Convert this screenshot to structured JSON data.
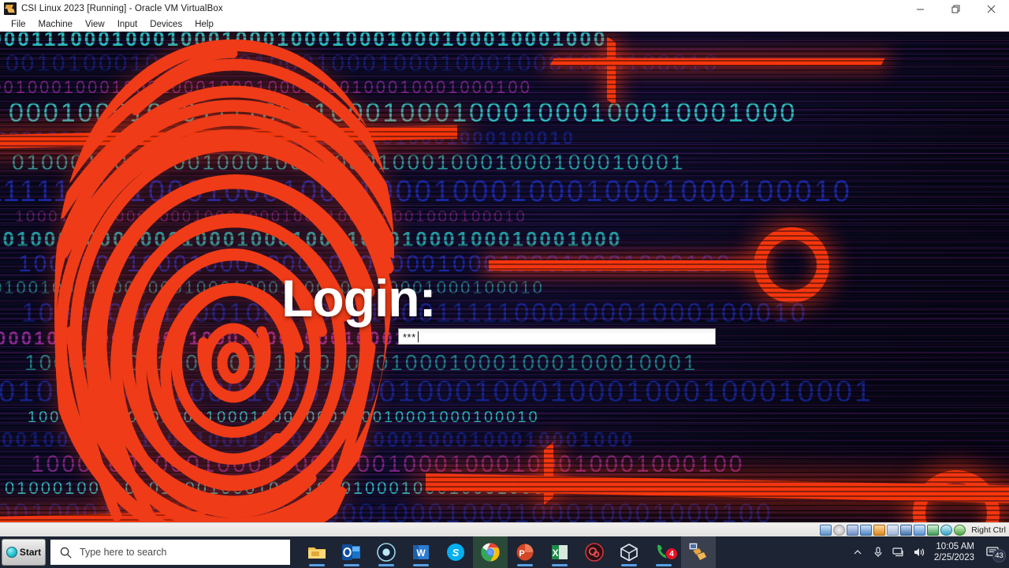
{
  "vbox": {
    "title": "CSI Linux 2023 [Running] - Oracle VM VirtualBox",
    "app_icon": "virtualbox-vm-icon",
    "menu": [
      {
        "label": "File"
      },
      {
        "label": "Machine"
      },
      {
        "label": "View"
      },
      {
        "label": "Input"
      },
      {
        "label": "Devices"
      },
      {
        "label": "Help"
      }
    ],
    "window_controls": [
      {
        "name": "minimize-button",
        "glyph": "minimize-icon"
      },
      {
        "name": "restore-button",
        "glyph": "restore-icon"
      },
      {
        "name": "close-button",
        "glyph": "close-icon"
      }
    ],
    "statusbar": {
      "host_key_label": "Right Ctrl",
      "indicators": [
        {
          "name": "hard-disk-indicator",
          "color": "#3b6fb0"
        },
        {
          "name": "optical-drive-indicator",
          "color": "#b8b8b8"
        },
        {
          "name": "floppy-indicator",
          "color": "#5a7fc0"
        },
        {
          "name": "network-indicator",
          "color": "#4a86c8"
        },
        {
          "name": "usb-indicator",
          "color": "#d8881f"
        },
        {
          "name": "shared-folders-indicator",
          "color": "#d8c468"
        },
        {
          "name": "display-indicator",
          "color": "#3f72b5"
        },
        {
          "name": "recording-indicator",
          "color": "#4d8fd0"
        },
        {
          "name": "features-indicator",
          "color": "#2f8f4f"
        },
        {
          "name": "mouse-indicator",
          "color": "#39a8c8"
        },
        {
          "name": "keyboard-indicator",
          "color": "#4aa33f"
        }
      ]
    }
  },
  "guest": {
    "login_label": "Login:",
    "password_field": {
      "value": "***",
      "masked_char": "*",
      "char_count": 3,
      "focused": true
    },
    "background": {
      "description": "binary-code-fingerprint-wallpaper",
      "colors": {
        "deep_navy": "#07081c",
        "binary_cyan": "#2fd8d8",
        "binary_blue": "#1b2db5",
        "binary_magenta": "#a12ea8",
        "trace_red": "#f4360c",
        "fingerprint_red": "#ef3b17"
      },
      "binary_rows": [
        "1000111000100010001000100010001000100010001000",
        "0010100010001000100010001000100010001000100010",
        "1001000100010001000100010001000100010001000100",
        "0001000100011110001000100010001000100010001000",
        "1000100010001000100010001000100010001000100010",
        "0100010001000100010001000100010001000100010001",
        "1111100010001000100010001000100010001000100010",
        "1000100010001000100010001000100010001000100010",
        "0010001000100010001000100010001000100010001000",
        "1001000100010001000100010001000100010001000100",
        "0100100010001000100010001000100010001000100010",
        "1000100010001000100010001111100010001000100010",
        "0001000100010001000100010001000100010001000100",
        "1000010001000100010001000100010001000100010001",
        "0100010001000100010001000100010001000100010001",
        "1000100010001000100010001000100010001000100010",
        "0010001000100010001000100010001000100010001000",
        "1000100100010001000100010001000100010001000100",
        "0100010001000100010001000100010001000100010001",
        "1001000100010001000100010001000100010001000100"
      ]
    }
  },
  "taskbar": {
    "start_label": "Start",
    "start_icon": "start-orb-icon",
    "search": {
      "placeholder": "Type here to search",
      "icon": "search-icon"
    },
    "apps": [
      {
        "name": "file-explorer",
        "icon": "folder-icon",
        "state": "running",
        "badge": null
      },
      {
        "name": "outlook",
        "icon": "outlook-icon",
        "state": "running",
        "badge": null
      },
      {
        "name": "screen-recorder",
        "icon": "record-circle-icon",
        "state": "running",
        "badge": null
      },
      {
        "name": "word",
        "icon": "word-icon",
        "state": "running",
        "badge": null
      },
      {
        "name": "skype",
        "icon": "skype-icon",
        "state": "idle",
        "badge": null
      },
      {
        "name": "chrome",
        "icon": "chrome-icon",
        "state": "highlighted",
        "badge": null
      },
      {
        "name": "powerpoint",
        "icon": "powerpoint-icon",
        "state": "running",
        "badge": null
      },
      {
        "name": "excel",
        "icon": "excel-icon",
        "state": "running",
        "badge": null
      },
      {
        "name": "obs-studio",
        "icon": "obs-icon",
        "state": "idle",
        "badge": null
      },
      {
        "name": "virtualbox",
        "icon": "virtualbox-box-icon",
        "state": "running",
        "badge": null
      },
      {
        "name": "phone-link",
        "icon": "phone-icon",
        "state": "running",
        "badge": "4"
      },
      {
        "name": "csi-linux-vm",
        "icon": "virtualbox-vm-icon",
        "state": "active",
        "badge": null
      }
    ],
    "tray": {
      "overflow_icon": "chevron-up-icon",
      "icons": [
        {
          "name": "microphone-icon"
        },
        {
          "name": "network-icon"
        },
        {
          "name": "volume-icon"
        }
      ],
      "clock": {
        "time": "10:05 AM",
        "date": "2/25/2023"
      },
      "action_center": {
        "icon": "notification-icon",
        "badge": "43"
      }
    }
  }
}
